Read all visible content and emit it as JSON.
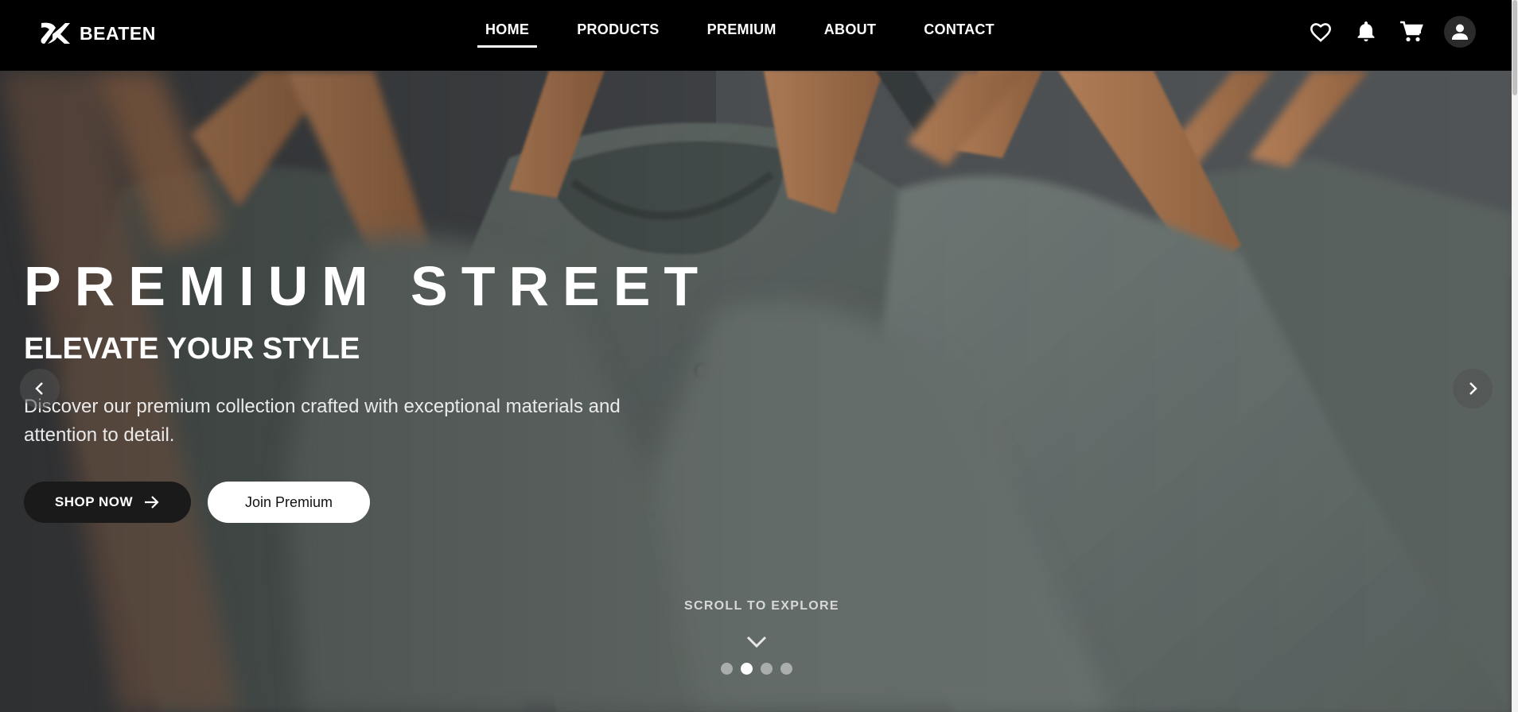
{
  "nav": {
    "brand": "BEATEN",
    "links": [
      {
        "label": "HOME",
        "active": true
      },
      {
        "label": "PRODUCTS",
        "active": false
      },
      {
        "label": "PREMIUM",
        "active": false
      },
      {
        "label": "ABOUT",
        "active": false
      },
      {
        "label": "CONTACT",
        "active": false
      }
    ],
    "icons": [
      "heart-icon",
      "bell-icon",
      "cart-icon",
      "user-icon"
    ]
  },
  "hero": {
    "headline": "PREMIUM STREET",
    "subheadline": "ELEVATE YOUR STYLE",
    "description": "Discover our premium collection crafted with exceptional materials and attention to detail.",
    "shop_button": "SHOP NOW",
    "premium_button": "Join Premium",
    "scroll_text": "SCROLL TO EXPLORE",
    "slides": 4,
    "active_slide": 2
  },
  "colors": {
    "navbar": "#000000",
    "shop_button": "#1a1a1a",
    "premium_button": "#ffffff",
    "shirt": "#5e6663",
    "hanger": "#b07a55"
  }
}
